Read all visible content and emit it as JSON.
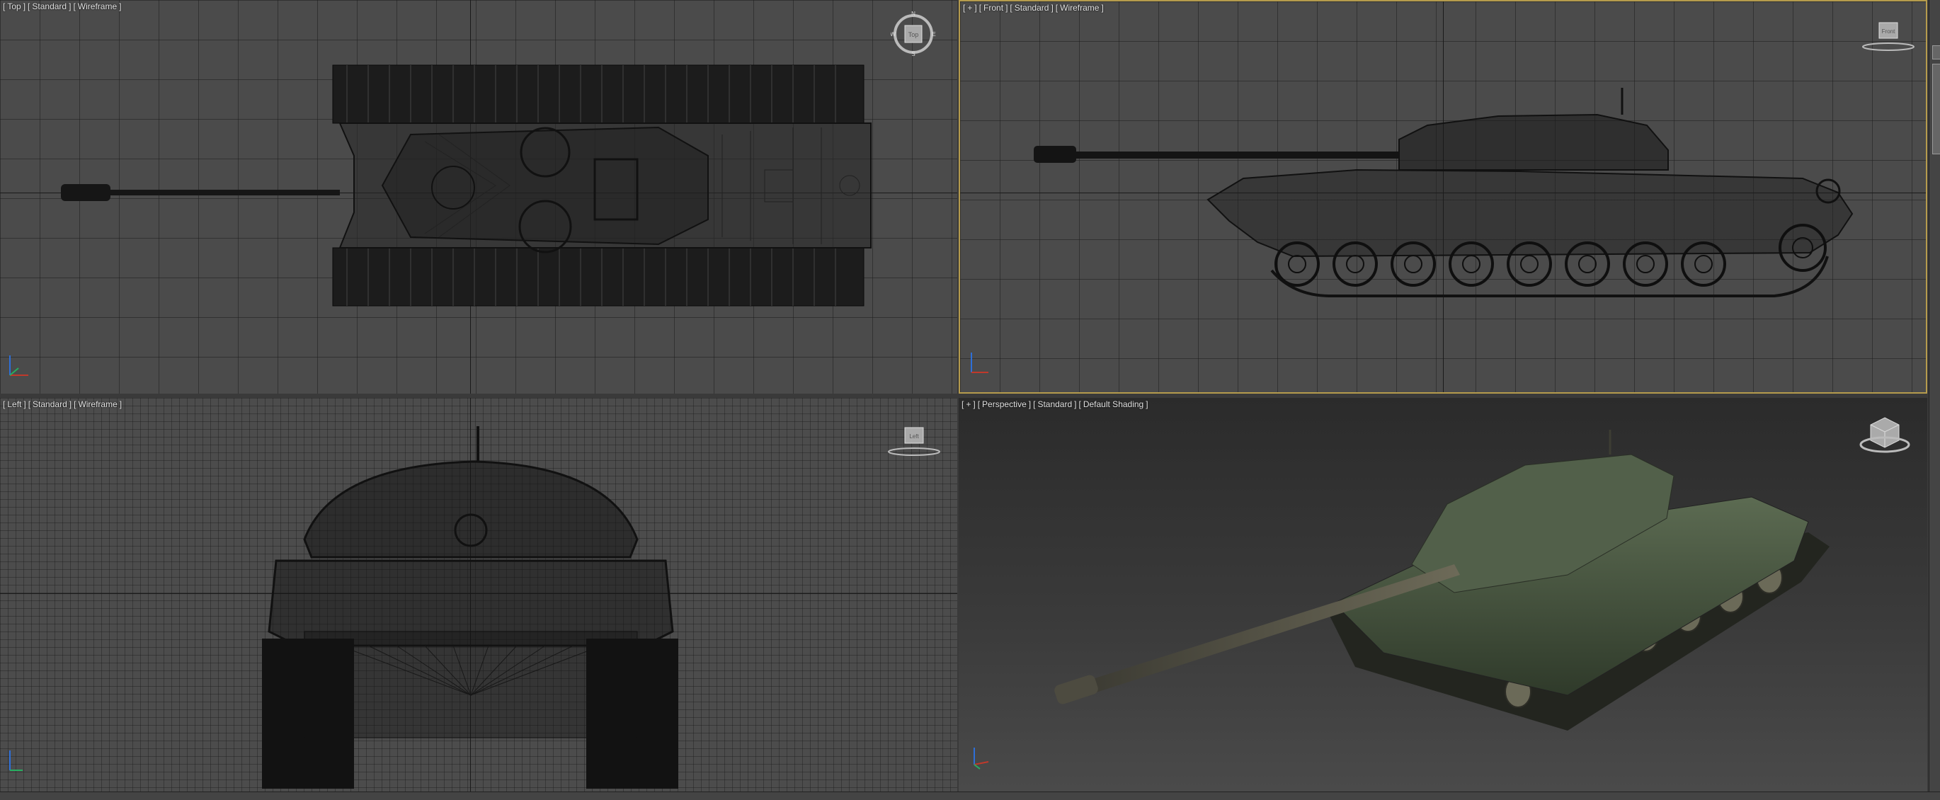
{
  "viewports": {
    "top": {
      "label": [
        "[",
        "Top",
        "]",
        "[",
        "Standard",
        "]",
        "[",
        "Wireframe",
        "]"
      ],
      "cube_face": "Top"
    },
    "front": {
      "label": [
        "[",
        "+",
        "]",
        "[",
        "Front",
        "]",
        "[",
        "Standard",
        "]",
        "[",
        "Wireframe",
        "]"
      ],
      "cube_face": "Front"
    },
    "left": {
      "label": [
        "[",
        "Left",
        "]",
        "[",
        "Standard",
        "]",
        "[",
        "Wireframe",
        "]"
      ],
      "cube_face": "Left"
    },
    "persp": {
      "label": [
        "[",
        "+",
        "]",
        "[",
        "Perspective",
        "]",
        "[",
        "Standard",
        "]",
        "[",
        "Default Shading",
        "]"
      ]
    }
  },
  "compass": {
    "n": "N",
    "s": "S",
    "e": "E",
    "w": "W"
  },
  "colors": {
    "active_border": "#b59b4d",
    "wire": "#111111",
    "tank_green": "#4f5c45",
    "axis_x": "#c0392b",
    "axis_y": "#27ae60",
    "axis_z": "#2e6fd8"
  },
  "icons": {
    "viewcube": "viewcube-icon",
    "axis": "axis-tripod-icon"
  }
}
